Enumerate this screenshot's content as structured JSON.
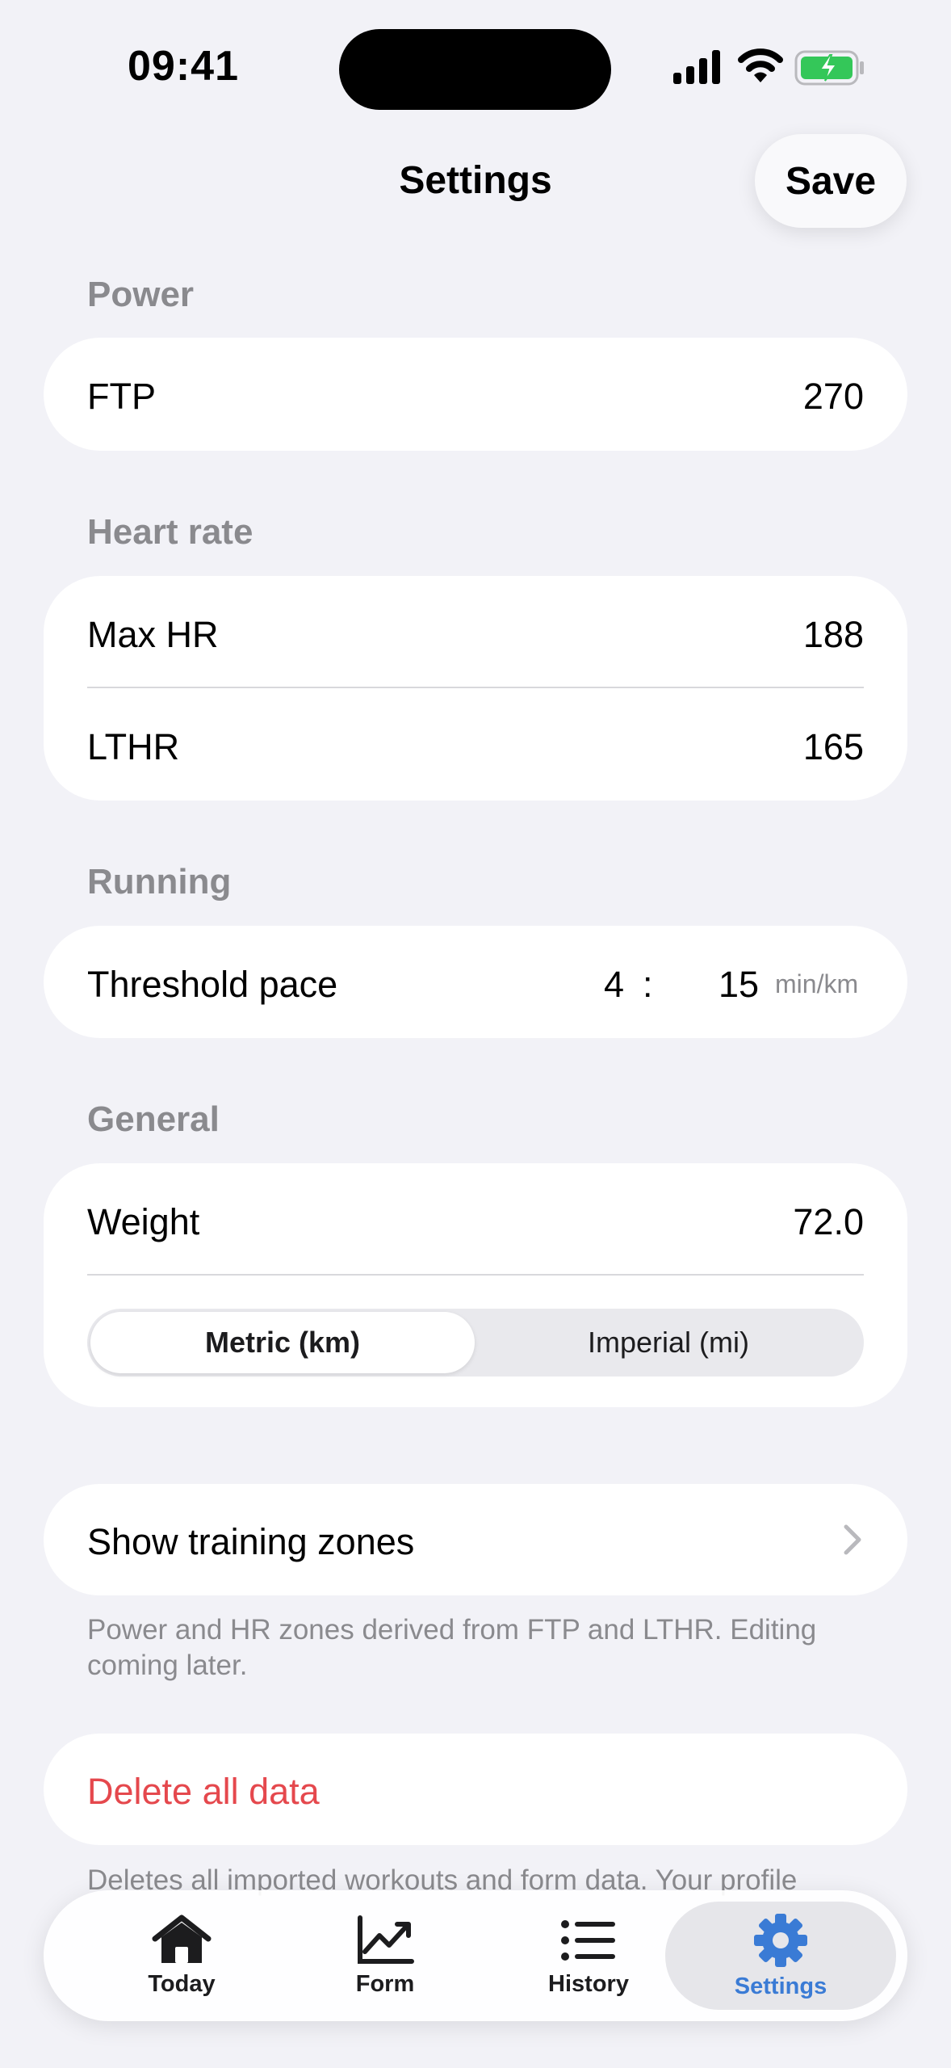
{
  "status_bar": {
    "time": "09:41"
  },
  "nav": {
    "title": "Settings",
    "save_label": "Save"
  },
  "sections": {
    "power": {
      "header": "Power",
      "ftp_label": "FTP",
      "ftp_value": "270"
    },
    "heart_rate": {
      "header": "Heart rate",
      "max_hr_label": "Max HR",
      "max_hr_value": "188",
      "lthr_label": "LTHR",
      "lthr_value": "165"
    },
    "running": {
      "header": "Running",
      "threshold_label": "Threshold pace",
      "pace_minutes": "4",
      "pace_separator": ":",
      "pace_seconds": "15",
      "pace_unit": "min/km"
    },
    "general": {
      "header": "General",
      "weight_label": "Weight",
      "weight_value": "72.0",
      "units_options": [
        "Metric (km)",
        "Imperial (mi)"
      ],
      "units_selected": "Metric (km)"
    }
  },
  "zones": {
    "label": "Show training zones",
    "footnote": "Power and HR zones derived from FTP and LTHR. Editing coming later."
  },
  "danger": {
    "delete_label": "Delete all data",
    "footnote": "Deletes all imported workouts and form data. Your profile"
  },
  "tabs": [
    {
      "label": "Today",
      "icon": "house-icon"
    },
    {
      "label": "Form",
      "icon": "chart-line-icon"
    },
    {
      "label": "History",
      "icon": "list-icon"
    },
    {
      "label": "Settings",
      "icon": "gear-icon"
    }
  ],
  "active_tab": "Settings",
  "colors": {
    "accent": "#3a7bd5",
    "destructive": "#e5484d",
    "background": "#f2f2f7",
    "battery": "#34c759"
  }
}
